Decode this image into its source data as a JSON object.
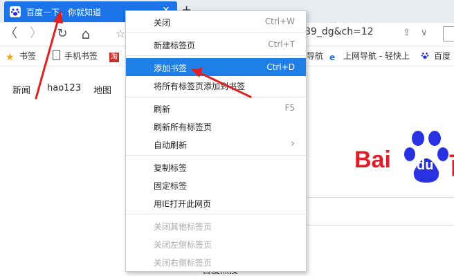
{
  "tabs": {
    "active_title": "百度一下，你就知道",
    "close_glyph": "✕",
    "new_tab_glyph": "+"
  },
  "toolbar": {
    "back_glyph": "〈",
    "forward_glyph": "〉",
    "reload_glyph": "↻",
    "home_glyph": "⌂",
    "star_glyph": "☆",
    "address_visible": "89_dg&ch=12",
    "share_glyph": "⇪",
    "dropdown_glyph": "∨"
  },
  "bookmarks": [
    {
      "label": "书签",
      "icon": "star-icon"
    },
    {
      "label": "手机书签",
      "icon": "phone-icon"
    },
    {
      "label": "导航",
      "icon": "nav-icon"
    },
    {
      "label": "上网导航 - 轻快上",
      "icon": "ie-icon"
    },
    {
      "label": "百度",
      "icon": "baidu-paw-icon"
    }
  ],
  "page": {
    "nav": [
      "新闻",
      "hao123",
      "地图"
    ],
    "logo_text": "Bai",
    "logo_du": "du",
    "bottom_text": "百度热搜"
  },
  "menu": {
    "items": [
      {
        "label": "关闭",
        "shortcut": "Ctrl+W",
        "state": "normal"
      },
      {
        "label": "新建标签页",
        "shortcut": "Ctrl+T",
        "state": "normal"
      },
      {
        "label": "添加书签",
        "shortcut": "Ctrl+D",
        "state": "highlighted"
      },
      {
        "label": "将所有标签页添加到书签",
        "shortcut": "",
        "state": "normal"
      },
      {
        "label": "刷新",
        "shortcut": "F5",
        "state": "normal"
      },
      {
        "label": "刷新所有标签页",
        "shortcut": "",
        "state": "normal"
      },
      {
        "label": "自动刷新",
        "shortcut": "›",
        "state": "normal"
      },
      {
        "label": "复制标签",
        "shortcut": "",
        "state": "normal"
      },
      {
        "label": "固定标签",
        "shortcut": "",
        "state": "normal"
      },
      {
        "label": "用IE打开此网页",
        "shortcut": "",
        "state": "normal"
      },
      {
        "label": "关闭其他标签页",
        "shortcut": "",
        "state": "disabled"
      },
      {
        "label": "关闭左侧标签页",
        "shortcut": "",
        "state": "disabled"
      },
      {
        "label": "关闭右侧标签页",
        "shortcut": "",
        "state": "disabled"
      }
    ]
  },
  "colors": {
    "accent": "#1a73e8",
    "highlight": "#1f7fe8",
    "annotation_arrow": "#e02020",
    "baidu_red": "#de1f27",
    "baidu_blue": "#2932e1"
  }
}
